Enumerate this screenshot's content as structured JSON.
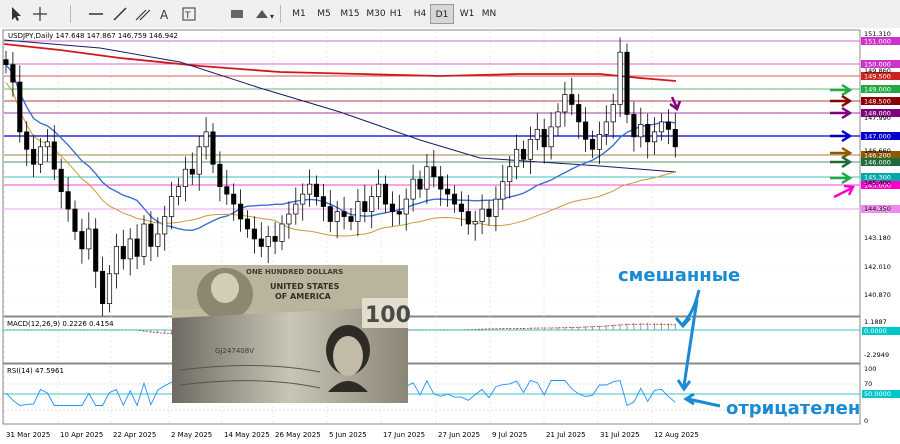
{
  "toolbar": {
    "tools": [
      "cursor-icon",
      "crosshair-icon",
      "horizontal-line-icon",
      "trendline-icon",
      "channel-icon",
      "text-icon",
      "label-icon",
      "rectangle-icon",
      "shapes-icon"
    ],
    "timeframes": [
      "M1",
      "M5",
      "M15",
      "M30",
      "H1",
      "H4",
      "D1",
      "W1",
      "MN"
    ],
    "active_timeframe": "D1"
  },
  "chart_header": "USDJPY,Daily  147.648 147.867 146.759 146.942",
  "price_axis": {
    "ticks": [
      "151.310",
      "149.860",
      "147.990",
      "146.660",
      "145.400",
      "144.350",
      "143.180",
      "142.010",
      "140.870",
      "139.700"
    ],
    "levels": [
      {
        "label": "151.000",
        "color": "#cc33cc",
        "price": 151.0
      },
      {
        "label": "150.000",
        "color": "#cc33cc",
        "price": 150.0
      },
      {
        "label": "149.500",
        "color": "#cc2222",
        "price": 149.5
      },
      {
        "label": "149.000",
        "color": "#22aa44",
        "price": 149.0
      },
      {
        "label": "148.500",
        "color": "#8b0000",
        "price": 148.5
      },
      {
        "label": "148.000",
        "color": "#800080",
        "price": 148.0
      },
      {
        "label": "147.000",
        "color": "#0000cc",
        "price": 147.0
      },
      {
        "label": "146.200",
        "color": "#8b5a00",
        "price": 146.2
      },
      {
        "label": "146.000",
        "color": "#1f6b3a",
        "price": 146.0
      },
      {
        "label": "145.300",
        "color": "#00aaaa",
        "price": 145.3
      },
      {
        "label": "145.000",
        "color": "#ff00cc",
        "price": 145.0
      },
      {
        "label": "144.000",
        "color": "#ee88ee",
        "price": 144.0
      }
    ]
  },
  "date_axis": [
    "31 Mar 2025",
    "10 Apr 2025",
    "22 Apr 2025",
    "2 May 2025",
    "14 May 2025",
    "26 May 2025",
    "5 Jun 2025",
    "17 Jun 2025",
    "27 Jun 2025",
    "9 Jul 2025",
    "21 Jul 2025",
    "31 Jul 2025",
    "12 Aug 2025"
  ],
  "macd": {
    "label": "MACD(12,26,9) 0.2226 0.4154",
    "ticks": [
      "1.1887",
      "0.0000",
      "-2.2949"
    ]
  },
  "rsi": {
    "label": "RSI(14) 47.5961",
    "ticks": [
      "100",
      "70",
      "50.0000",
      "0"
    ]
  },
  "annotations": {
    "mixed": "смешанные",
    "negative": "отрицателен"
  },
  "banknote_text": {
    "usd_top": "ONE HUNDRED DOLLARS",
    "usd_mid": "UNITED STATES",
    "usd_bottom": "OF AMERICA",
    "jpy_value": "100",
    "jpy_serial": "GJ247408V"
  }
}
